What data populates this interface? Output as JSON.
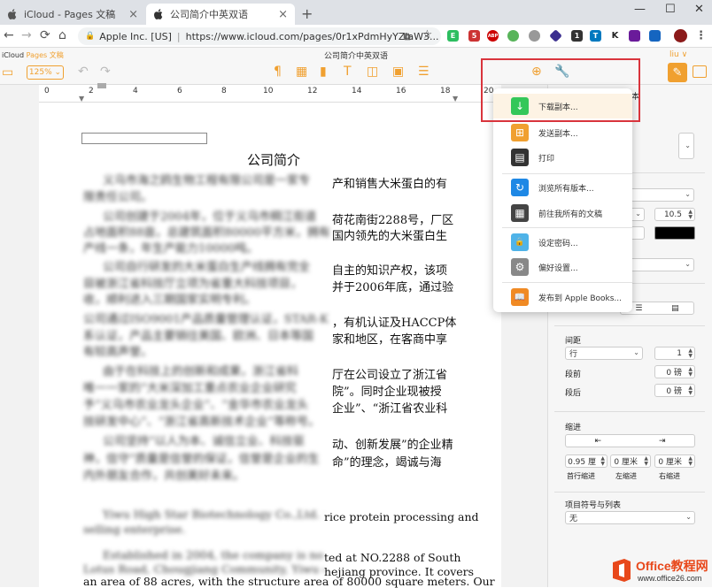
{
  "browser": {
    "tabs": [
      {
        "title": "iCloud - Pages 文稿",
        "icon": "apple-icon",
        "active": false
      },
      {
        "title": "公司简介中英双语",
        "icon": "apple-icon",
        "active": true
      }
    ],
    "new_tab": "+",
    "window_controls": {
      "minimize": "—",
      "maximize": "☐",
      "close": "✕"
    },
    "nav": {
      "back": "←",
      "forward": "→",
      "reload": "⟳",
      "home": "⌂"
    },
    "site_identity": "Apple Inc. [US]",
    "url": "https://www.icloud.com/pages/0r1xPdmHyYZlaW3...",
    "extensions": [
      {
        "name": "evernote-icon",
        "color": "#2dbe60",
        "glyph": "E"
      },
      {
        "name": "mail-icon",
        "color": "#c33",
        "glyph": "5"
      },
      {
        "name": "adblock-icon",
        "color": "#c00",
        "glyph": "ABP"
      },
      {
        "name": "circle-green-icon",
        "color": "#58b45a",
        "glyph": ""
      },
      {
        "name": "circle-gray-icon",
        "color": "#999",
        "glyph": ""
      },
      {
        "name": "cube-icon",
        "color": "#3b2f8f",
        "glyph": ""
      },
      {
        "name": "badge-1-icon",
        "color": "#333",
        "glyph": "1"
      },
      {
        "name": "trello-icon",
        "color": "#0079bf",
        "glyph": "T"
      },
      {
        "name": "k-icon",
        "color": "#ffffff",
        "glyph": "K"
      },
      {
        "name": "purple-ext-icon",
        "color": "#6a1b9a",
        "glyph": ""
      },
      {
        "name": "translate-ext-icon",
        "color": "#1565c0",
        "glyph": ""
      },
      {
        "name": "profile-avatar-icon",
        "color": "#8b1a1a",
        "glyph": ""
      },
      {
        "name": "menu-dots-icon",
        "color": "#ffffff",
        "glyph": "⋮"
      }
    ]
  },
  "app": {
    "brand_left": "iCloud",
    "brand_right": "Pages 文稿",
    "document_title": "公司简介中英双语",
    "zoom": "125%",
    "user": "liu ∨",
    "colors": {
      "accent": "#f0a030",
      "highlight_box": "#d9343c"
    }
  },
  "ruler": {
    "labels": [
      "0",
      "2",
      "4",
      "6",
      "8",
      "10",
      "12",
      "14",
      "16",
      "18",
      "20"
    ]
  },
  "document": {
    "heading": "公司简介",
    "zh_lines": [
      {
        "blur": "义乌市海之鸥生物工程有限公司是一家专",
        "clear": "产和销售大米蛋白的有"
      },
      {
        "blur": "限责任公司。",
        "clear": ""
      },
      {
        "blur": "公司创建于2004年，位于义乌市稠江街道",
        "clear": "荷花南街2288号，厂区"
      },
      {
        "blur": "占地面积88亩，总建筑面积80000平方米，拥有",
        "clear": "国内领先的大米蛋白生"
      },
      {
        "blur": "产线一条，年生产能力10000吨。",
        "clear": ""
      },
      {
        "blur": "公司自行研发的大米蛋白生产线拥有完全",
        "clear": "自主的知识产权，该项"
      },
      {
        "blur": "目被浙江省科技厅立项为省重大科技项目，",
        "clear": "并于2006年底，通过验"
      },
      {
        "blur": "收，顺利进入三期国家实明专利。",
        "clear": ""
      },
      {
        "blur": "公司通过ISO9001产品质量管理认证，STAR-K",
        "clear": "，有机认证及HACCP体"
      },
      {
        "blur": "系认证，产品主要销往美国、欧洲、日本等国",
        "clear": "家和地区，在客商中享"
      },
      {
        "blur": "有较高声誉。",
        "clear": ""
      },
      {
        "blur": "由于在科技上的创新和成果，浙江省科",
        "clear": "厅在公司设立了浙江省"
      },
      {
        "blur": "唯一一家的“大米深加工重点农业企业研究",
        "clear": "院”。同时企业现被授"
      },
      {
        "blur": "予“义乌市农业龙头企业”、“金华市农业龙头",
        "clear": "企业”、“浙江省农业科"
      },
      {
        "blur": "技研发中心”、“浙江省高新技术企业”等称号。",
        "clear": ""
      },
      {
        "blur": "公司坚持“以人为本、诚信立业、科技驱",
        "clear": "动、创新发展”的企业精"
      },
      {
        "blur": "神，信守“质量是信誉的保证，信誉是企业的生",
        "clear": "命”的理念，竭诚与海"
      },
      {
        "blur": "内外朋友合作，共创美好未来。",
        "clear": ""
      }
    ],
    "en_lines": [
      {
        "blur": "Yiwu High Star Biotechnology Co.,Ltd. is a ",
        "clear": "rice protein processing and"
      },
      {
        "blur": "selling enterprise.",
        "clear": ""
      },
      {
        "blur": "Established in 2004, the company is now loca",
        "clear": "ted at NO.2288 of   South"
      },
      {
        "blur": "Lotus Road, Chougjiang Community, Yiwu city of Z",
        "clear": "hejiang province. It covers"
      },
      {
        "blur": "",
        "clear": "an area of 88 acres, with the structure area of 80000 square meters. Our"
      }
    ]
  },
  "menu": {
    "items": [
      {
        "label": "下载副本...",
        "icon": "download-icon",
        "color": "#34c759",
        "glyph": "↓"
      },
      {
        "label": "发送副本...",
        "icon": "send-copy-icon",
        "color": "#f0a030",
        "glyph": "⊞"
      },
      {
        "label": "打印",
        "icon": "print-icon",
        "color": "#333333",
        "glyph": "▤"
      },
      {
        "label": "浏览所有版本...",
        "icon": "versions-icon",
        "color": "#1e88e5",
        "glyph": "↻"
      },
      {
        "label": "前往我所有的文稿",
        "icon": "grid-icon",
        "color": "#444444",
        "glyph": "▦"
      },
      {
        "label": "设定密码...",
        "icon": "lock-icon",
        "color": "#4fb3e8",
        "glyph": "🔒"
      },
      {
        "label": "偏好设置...",
        "icon": "gear-icon",
        "color": "#888888",
        "glyph": "⚙"
      },
      {
        "label": "发布到 Apple Books...",
        "icon": "books-icon",
        "color": "#f08a24",
        "glyph": "📖"
      }
    ]
  },
  "panel": {
    "partial_title": "本",
    "font_size": "10.5",
    "spacing_label": "间距",
    "spacing_unit": "行",
    "spacing_value": "1",
    "before_label": "段前",
    "before_value": "0 磅",
    "after_label": "段后",
    "after_value": "0 磅",
    "indent_label": "缩进",
    "first_indent_value": "0.95 厘",
    "left_indent_value": "0 厘米",
    "right_indent_value": "0 厘米",
    "first_indent_label": "首行缩进",
    "left_indent_label": "左缩进",
    "right_indent_label": "右缩进",
    "list_label": "项目符号与列表",
    "list_value": "无",
    "partial_select": "n"
  },
  "watermark": {
    "brand": "Office教程网",
    "url": "www.office26.com"
  }
}
